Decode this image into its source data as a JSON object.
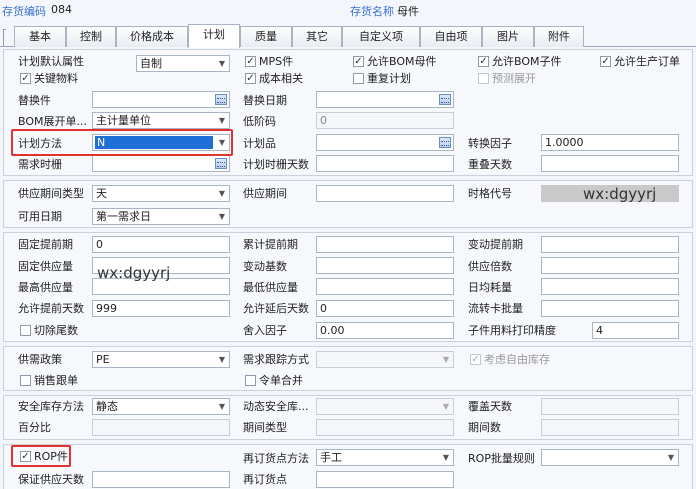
{
  "header": {
    "code_label": "存货编码",
    "code_value": "084",
    "name_label": "存货名称",
    "name_value": "母件"
  },
  "tabs": [
    "基本",
    "控制",
    "价格成本",
    "计划",
    "质量",
    "其它",
    "自定义项",
    "自由项",
    "图片",
    "附件"
  ],
  "active_tab": "计划",
  "s1": {
    "plan_default_attr": "计划默认属性",
    "plan_default_value": "自制",
    "mps": "MPS件",
    "allow_bom_parent": "允许BOM母件",
    "allow_bom_child": "允许BOM子件",
    "allow_production_order": "允许生产订单",
    "key_material": "关键物料",
    "cost_related": "成本相关",
    "replan": "重复计划",
    "forecast_expand": "预测展开",
    "substitute": "替换件",
    "substitute_date": "替换日期",
    "bom_expand_unit": "BOM展开单...",
    "bom_expand_unit_value": "主计量单位",
    "low_level_code": "低阶码",
    "low_level_value": "0",
    "plan_method": "计划方法",
    "plan_method_value": "N",
    "plan_item": "计划品",
    "conversion_factor": "转换因子",
    "conversion_factor_value": "1.0000",
    "demand_fence": "需求时栅",
    "plan_fence_days": "计划时栅天数",
    "reschedule_days": "重叠天数"
  },
  "s2": {
    "supply_period_type": "供应期间类型",
    "supply_period_type_value": "天",
    "supply_period": "供应期间",
    "time_bucket": "时格代号",
    "available_date": "可用日期",
    "available_date_value": "第一需求日"
  },
  "s3": {
    "fixed_lead": "固定提前期",
    "fixed_lead_value": "0",
    "cum_lead": "累计提前期",
    "variable_lead": "变动提前期",
    "fixed_supply": "固定供应量",
    "variable_base": "变动基数",
    "supply_multiple": "供应倍数",
    "max_supply": "最高供应量",
    "min_supply": "最低供应量",
    "daily_capacity": "日均耗量",
    "allow_advance_days": "允许提前天数",
    "allow_advance_value": "999",
    "allow_delay_days": "允许延后天数",
    "allow_delay_value": "0",
    "flow_card_batch": "流转卡批量",
    "cut_tail": "切除尾数",
    "loss_factor": "舍入因子",
    "loss_factor_value": "0.00",
    "child_print_precision": "子件用料打印精度",
    "child_print_precision_value": "4"
  },
  "s4": {
    "supply_demand_policy": "供需政策",
    "supply_demand_policy_value": "PE",
    "demand_trace": "需求跟踪方式",
    "consider_free_stock": "考虑自由库存",
    "sales_follow": "销售跟单",
    "order_merge": "令单合并"
  },
  "s5": {
    "safety_stock_method": "安全库存方法",
    "safety_stock_method_value": "静态",
    "dynamic_safety": "动态安全库...",
    "cover_days": "覆盖天数",
    "percent": "百分比",
    "period_type": "期间类型",
    "period_count": "期间数"
  },
  "s6": {
    "rop": "ROP件",
    "reorder_method": "再订货点方法",
    "reorder_method_value": "手工",
    "rop_batch_rule": "ROP批量规则",
    "guarantee_supply_days": "保证供应天数",
    "reorder_point": "再订货点"
  },
  "watermarks": [
    "wx:dgyyrj",
    "wx:dgyyrj"
  ],
  "colors": {
    "highlight": "#e0322e",
    "selected": "#1f6fd6",
    "label_blue": "#3a6fd8"
  }
}
